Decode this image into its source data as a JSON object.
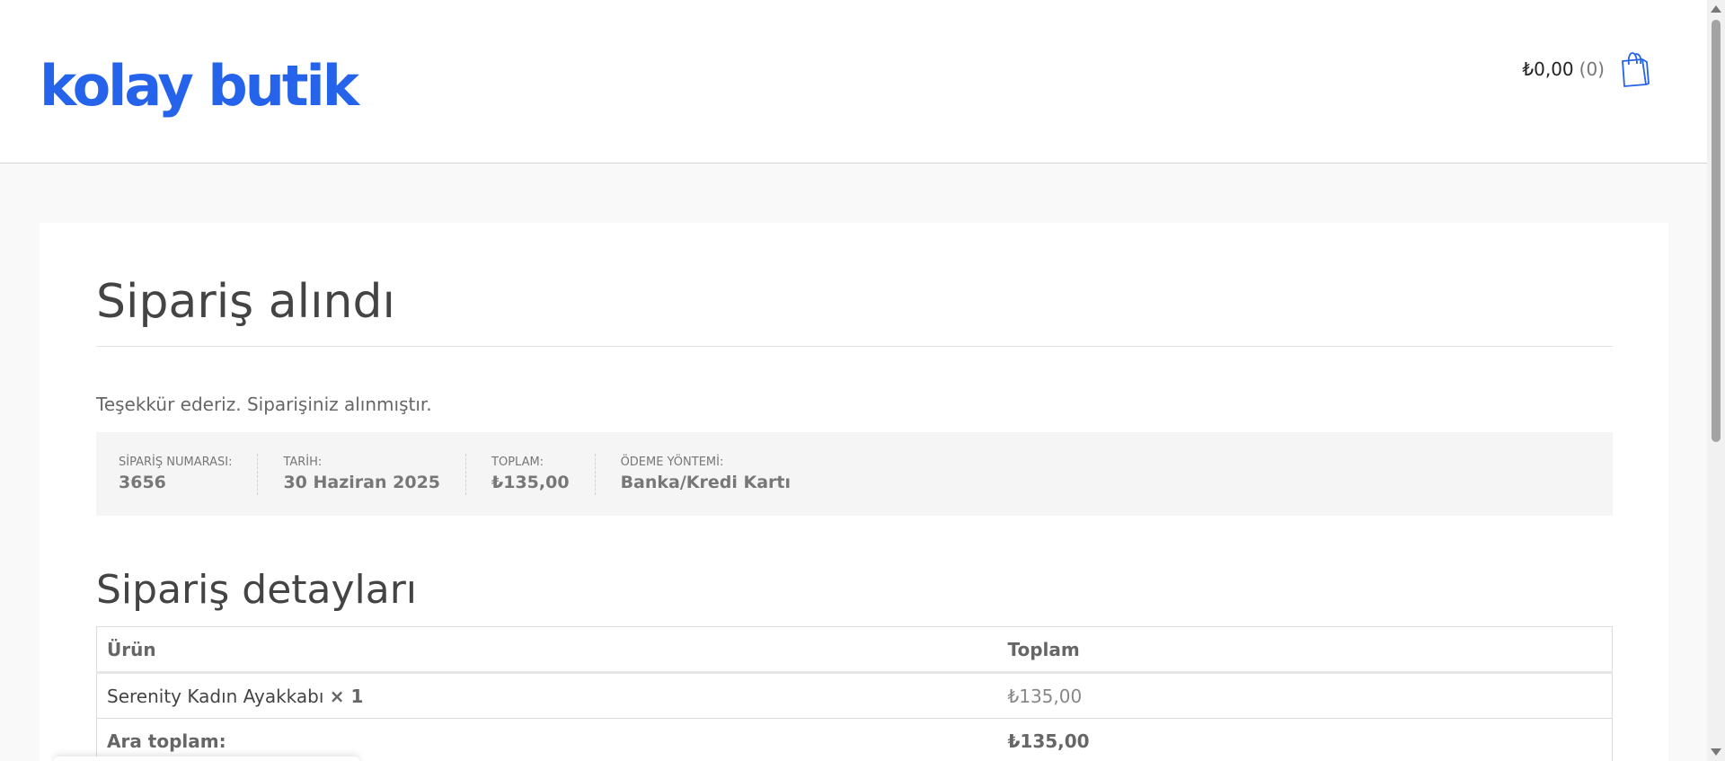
{
  "header": {
    "logo_text": "kolay butik",
    "cart_total": "₺0,00",
    "cart_count": "(0)",
    "cart_icon": "shopping-bag-icon",
    "brand_color": "#2563eb"
  },
  "page": {
    "title": "Sipariş alındı",
    "thanks_message": "Teşekkür ederiz. Siparişiniz alınmıştır."
  },
  "overview": [
    {
      "label": "SİPARİŞ NUMARASI:",
      "value": "3656"
    },
    {
      "label": "TARİH:",
      "value": "30 Haziran 2025"
    },
    {
      "label": "TOPLAM:",
      "value": "₺135,00"
    },
    {
      "label": "ÖDEME YÖNTEMİ:",
      "value": "Banka/Kredi Kartı"
    }
  ],
  "details": {
    "title": "Sipariş detayları",
    "headers": {
      "product": "Ürün",
      "total": "Toplam"
    },
    "items": [
      {
        "name": "Serenity Kadın Ayakkabı",
        "qty": "× 1",
        "total": "₺135,00"
      }
    ],
    "subtotal_label": "Ara toplam:",
    "subtotal_value": "₺135,00"
  }
}
